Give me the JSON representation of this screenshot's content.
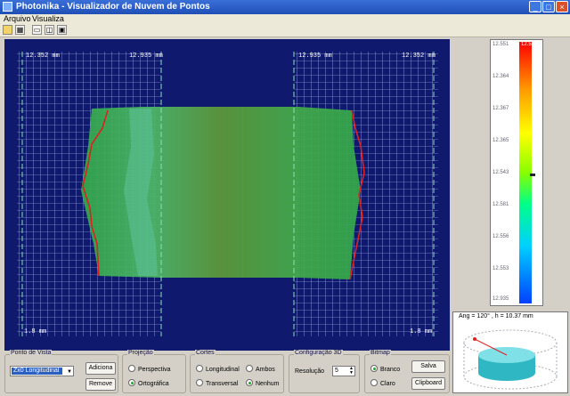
{
  "window": {
    "title": "Photonika - Visualizador de Nuvem de Pontos",
    "controls": {
      "minimize": "_",
      "maximize": "□",
      "close": "×"
    }
  },
  "menu": [
    {
      "label": "Arquivo"
    },
    {
      "label": "Visualiza"
    }
  ],
  "toolbar": [
    {
      "icon": "open-folder-icon"
    },
    {
      "icon": "grid-icon"
    },
    {
      "icon": "view-single-icon"
    },
    {
      "icon": "view-split-icon"
    },
    {
      "icon": "view-3d-icon"
    }
  ],
  "colors": {
    "panel_bg": "#0f1a6e",
    "grid": "#c8d4ff",
    "cylinder_green": "#3cb046",
    "edge_red": "#e02020",
    "cutline": "#8ce0b4"
  },
  "viewport": {
    "labels": {
      "top_left_a": "12.352 mm",
      "top_left_b": "12.935 mm",
      "top_right_a": "12.935 mm",
      "top_right_b": "12.352 mm",
      "bottom_left": "1.8 mm",
      "bottom_right": "1.8 mm"
    }
  },
  "colorbar": {
    "ticks": [
      "12.551",
      "12.364",
      "12.367",
      "12.365",
      "12.543",
      "12.581",
      "12.556",
      "12.553",
      "12.935"
    ],
    "top_value": "12.551"
  },
  "view3d": {
    "info": "Ang = 120° , h = 10.37 mm"
  },
  "panels": {
    "ponto_de_vista": {
      "title": "Ponto de Vista",
      "combo_value": "Zx0 Longitudinal",
      "add_label": "Adiciona",
      "remove_label": "Remove"
    },
    "projecao": {
      "title": "Projeção",
      "options": [
        "Perspectiva",
        "Ortográfica"
      ],
      "selected": 1
    },
    "cortes": {
      "title": "Cortes",
      "longitudinal": "Longitudinal",
      "ambos": "Ambos",
      "transversal": "Transversal",
      "nenhum": "Nenhum",
      "selected": "nenhum"
    },
    "config3d": {
      "title": "Configuração 3D",
      "resolucao_label": "Resolução",
      "resolucao_value": "5"
    },
    "bitmap": {
      "title": "Bitmap",
      "options": [
        "Branco",
        "Claro"
      ],
      "selected": 0,
      "save_label": "Salva",
      "clipboard_label": "Clipboard"
    }
  }
}
